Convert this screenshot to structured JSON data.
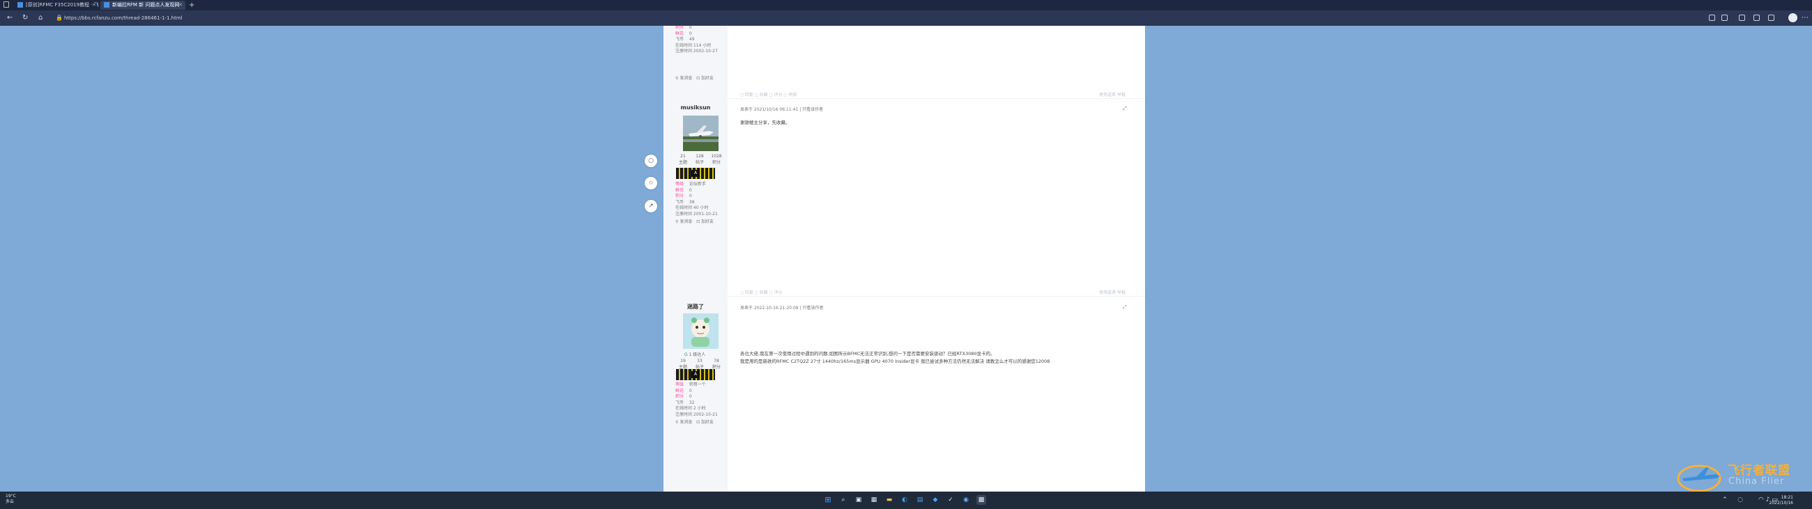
{
  "browser": {
    "tabs": [
      {
        "label": "[原创]RFMC F35C2019教程 · 飞..."
      },
      {
        "label": "新编拉RFM 新 问题点人发现网"
      }
    ],
    "new_tab_symbol": "+",
    "url": "https://bbs.rcfanzu.com/thread-286461-1-1.html"
  },
  "sidetools": [
    "comment-icon",
    "star-icon",
    "share-icon"
  ],
  "posts": [
    {
      "fields": [
        {
          "label": "积分",
          "value": "0"
        },
        {
          "label": "鲜花",
          "value": "0"
        },
        {
          "label": "飞币",
          "value": "49"
        },
        {
          "label": "在线时间",
          "value": "114 小时"
        },
        {
          "label": "注册时间",
          "value": "2002-10-27"
        }
      ],
      "links": [
        "发消息",
        "加好友"
      ],
      "actions_left": "◻ 回复   ◻ 收藏   ◻ 评分   ◻ 举报",
      "actions_right": "使用道具   举报"
    },
    {
      "username": "musiksun",
      "stats": [
        "21",
        "128",
        "1028"
      ],
      "stat_labels": [
        "主题",
        "帖子",
        "积分"
      ],
      "medal_label": "A",
      "fields": [
        {
          "label": "等级",
          "value": "论坛新手"
        },
        {
          "label": "鲜花",
          "value": "0"
        },
        {
          "label": "积分",
          "value": "0"
        },
        {
          "label": "飞币",
          "value": "38"
        },
        {
          "label": "在线时间",
          "value": "40 小时"
        },
        {
          "label": "注册时间",
          "value": "2001-10-21"
        }
      ],
      "links": [
        "发消息",
        "加好友"
      ],
      "meta": "发表于 2021/10/16 06:11:41  |  只看该作者",
      "content": "谢谢楼主分享，先收藏。",
      "actions_left": "◻ 回复   ◻ 收藏   ◻ 评分",
      "actions_right": "使用道具   举报"
    },
    {
      "username": "迷路了",
      "badge": "1 级达人",
      "stats": [
        "19",
        "33",
        "78"
      ],
      "stat_labels": [
        "主题",
        "帖子",
        "积分"
      ],
      "medal_label": "A",
      "fields": [
        {
          "label": "等级",
          "value": "帅哥一个"
        },
        {
          "label": "鲜花",
          "value": "0"
        },
        {
          "label": "积分",
          "value": "0"
        },
        {
          "label": "飞币",
          "value": "32"
        },
        {
          "label": "在线时间",
          "value": "2 小时"
        },
        {
          "label": "注册时间",
          "value": "2002-10-21"
        }
      ],
      "links": [
        "发消息",
        "加好友"
      ],
      "meta": "发表于 2022-10-16 21:20:08  |  只看该作者",
      "content_lines": [
        "各位大佬,我在第一次使用过程中遇到的问题,如图所示BFMC无法正常识别,想问一下是否需要安装驱动？已经RTX3080显卡的。",
        "我是用的是新款的RFMC C2TQ2Z 27寸 1440hz/165ms显示器 GPU 4070 Insider显卡 我已尝试多种方法仍然无法解决 请教怎么才可以的感谢您12008"
      ]
    }
  ],
  "taskbar": {
    "weather_temp": "19°C",
    "weather_text": "多云",
    "time": "18:21",
    "date": "2022/10/16"
  },
  "watermark": {
    "title": "飞行者联盟",
    "subtitle": "China Flier"
  }
}
